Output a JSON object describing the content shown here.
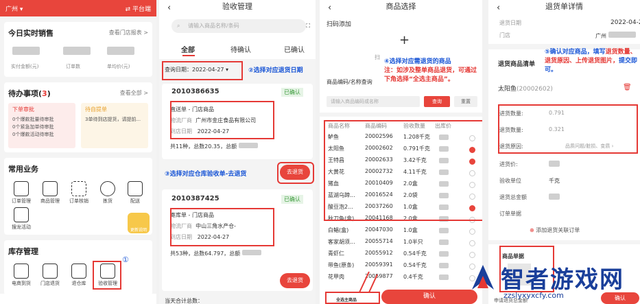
{
  "p1": {
    "location": "广州",
    "platform": "平台端",
    "sales_title": "今日实时销售",
    "store_report": "查看门店报表 >",
    "stats": [
      "实付金额(元)",
      "订单数",
      "单均价(元)"
    ],
    "todo_title": "待办事项(",
    "todo_count": "3",
    "todo_close": ")",
    "view_all": "查看全部 >",
    "todo_a_title": "下单审批",
    "todo_a": [
      "0个爆款批量待审批",
      "0个紧急加单待审批",
      "0个爆款活动待审批"
    ],
    "todo_b_title": "待自提单",
    "todo_b": "3单待到店提货，请提前...",
    "common_title": "常用业务",
    "common_items": [
      "订单管理",
      "商品管理",
      "订单核销",
      "拣货",
      "配送",
      "搜龙活动"
    ],
    "upgrade_badge": "更新说明",
    "stock_title": "库存管理",
    "stock_items": [
      "电商到货",
      "门店退货",
      "退仓库",
      "验收管理"
    ],
    "marker": "①"
  },
  "p2": {
    "title": "验收管理",
    "search_ph": "请输入商品名称/条码",
    "tabs": [
      "全部",
      "待确认",
      "已确认"
    ],
    "date_label": "查询日期：",
    "date_value": "2022-04-27",
    "note2": "②选择对应退货日期",
    "orders": [
      {
        "no": "2010386635",
        "status": "已确认",
        "type": "直送单 - 门店商品",
        "supplier_label": "物流厂商",
        "supplier": "广州市金庄食品有限公司",
        "date_label": "到店日期",
        "date": "2022-04-27",
        "summary": "共11种，总数20.35，总额",
        "button": "去退货"
      },
      {
        "no": "2010387425",
        "status": "已确认",
        "type": "寄库单 - 门店商品",
        "supplier_label": "物流厂商",
        "supplier": "中山三角水产仓-",
        "date_label": "到店日期",
        "date": "2022-04-27",
        "summary": "共53种，总数64.797，总额",
        "button": "去退货"
      }
    ],
    "note3": "③选择对应仓库验收单-去退货",
    "bottom_text": "当天合计总数："
  },
  "p3": {
    "title": "商品选择",
    "scan_label": "扫码添加",
    "scan_hint": "扫",
    "search_label": "商品编码/名称查询",
    "search_ph": "请输入商品编码或名称",
    "query_btn": "查询",
    "reset_btn": "重置",
    "note4_title": "④选择对应需退货的商品",
    "note4_body": "注：如涉及整单商品退货，可通过下角选择“全选主商品”。",
    "columns": [
      "商品名称",
      "商品编码",
      "验收数量",
      "出库价"
    ],
    "rows": [
      [
        "鲈鱼",
        "20002596",
        "1.208千克",
        false
      ],
      [
        "太阳鱼",
        "20002602",
        "0.791千克",
        true
      ],
      [
        "王特昌",
        "20002633",
        "3.42千克",
        true
      ],
      [
        "大黄花",
        "20002732",
        "4.11千克",
        false
      ],
      [
        "猪血",
        "20010409",
        "2.0盒",
        false
      ],
      [
        "蓝湖乌蹄...",
        "20016524",
        "2.0袋",
        false
      ],
      [
        "酸豆泡2...",
        "20037260",
        "1.0盒",
        true
      ],
      [
        "秋刀鱼(盒)",
        "20041168",
        "2.0盒",
        false
      ],
      [
        "白鲳(盒)",
        "20047030",
        "1.0盒",
        false
      ],
      [
        "客家胡须...",
        "20055714",
        "1.0半只",
        false
      ],
      [
        "青虾仁",
        "20055912",
        "0.54千克",
        false
      ],
      [
        "带鱼(原条)",
        "20059391",
        "0.54千克",
        false
      ],
      [
        "花甲肉",
        "20059877",
        "0.4千克",
        false
      ]
    ],
    "select_all": "全选主商品",
    "confirm": "确认"
  },
  "p4": {
    "title": "退货单详情",
    "return_date_label": "退货日期",
    "return_date": "2022-04-27",
    "store_label": "门店",
    "store": "广州",
    "list_label": "退货商品清单",
    "note5": "⑤确认对应商品，填写",
    "note5_r": "退货数量、退货原因、上传退货图片，",
    "note5_end": "提交即可。",
    "item": "太阳鱼",
    "item_code": "(20002602)",
    "in_qty_label": "进货数量:",
    "in_qty": "0.791",
    "ret_qty_label": "退货数量:",
    "ret_qty": "0.321",
    "reason_label": "退货原因:",
    "reason": "品质问题/脏损、变质",
    "price_label": "进货价:",
    "unit_label": "验收单位",
    "unit": "千克",
    "amount_label": "退货总金额",
    "order_label": "订单单据",
    "add_order": "添加退货关联订单",
    "product_doc": "商品单据",
    "footer": "申请退货总金额",
    "submit": "确认"
  },
  "watermark": "智者游戏网",
  "watermark_url": "zzslyxyxcfy.com"
}
